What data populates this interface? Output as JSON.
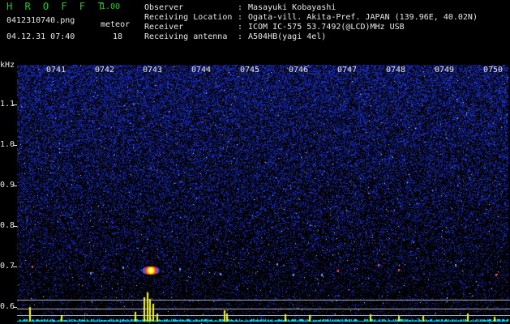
{
  "header": {
    "app_title": "H R O F F T",
    "app_version": "1.00",
    "filename": "0412310740.png",
    "meteor_label": "meteor",
    "datetime": "04.12.31 07:40",
    "meteor_count": "18"
  },
  "station_info": [
    {
      "key": "Observer",
      "value": "Masayuki Kobayashi"
    },
    {
      "key": "Receiving Location",
      "value": "Ogata-vill. Akita-Pref. JAPAN (139.96E, 40.02N)"
    },
    {
      "key": "Receiver",
      "value": "ICOM IC-575 53.7492(@LCD)MHz USB"
    },
    {
      "key": "Receiving antenna",
      "value": "A504HB(yagi 4el)"
    }
  ],
  "info_separator": ":",
  "spectrogram": {
    "y_unit": "kHz",
    "y_ticks": [
      "1.1",
      "1.0",
      "0.9",
      "0.8",
      "0.7",
      "0.6"
    ],
    "x_ticks": [
      "0741",
      "0742",
      "0743",
      "0744",
      "0745",
      "0746",
      "0747",
      "0748",
      "0749",
      "0750"
    ],
    "colors": {
      "background": "#000000",
      "noise": "#1a2a9a",
      "signal_line": "#ffff00",
      "baseline": "#00e5ff",
      "label_text": "#e8e8e8",
      "title_green": "#19d21c"
    }
  }
}
